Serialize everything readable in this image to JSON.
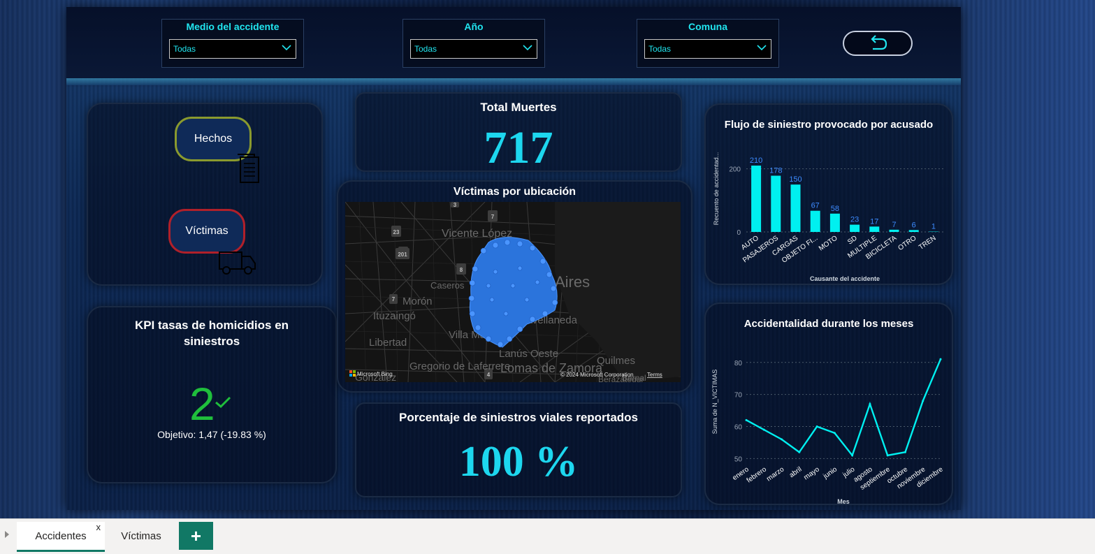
{
  "filters": [
    {
      "label": "Medio del accidente",
      "value": "Todas"
    },
    {
      "label": "Año",
      "value": "Todas"
    },
    {
      "label": "Comuna",
      "value": "Todas"
    }
  ],
  "nav": {
    "hechos": "Hechos",
    "victimas": "Víctimas"
  },
  "kpi_homicidios": {
    "title": "KPI tasas de homicidios en siniestros",
    "value": "2",
    "target": "Objetivo: 1,47 (-19.83 %)"
  },
  "total_muertes": {
    "title": "Total Muertes",
    "value": "717"
  },
  "map": {
    "title": "Víctimas por ubicación",
    "labels": [
      "Vicente López",
      "Aires",
      "Caseros",
      "Morón",
      "Ituzaingó",
      "Avellaneda",
      "Libertad",
      "Villa Madero",
      "Lanús Oeste",
      "Quilmes",
      "Gregorio de Laferrere",
      "Lomas de Zamora",
      "Bernal",
      "González",
      "Berazategui"
    ],
    "route_badges": [
      "3",
      "7",
      "23",
      "201",
      "8",
      "7",
      "4"
    ],
    "brand": "Microsoft Bing",
    "copyright": "© 2024 Microsoft Corporation",
    "terms": "Terms"
  },
  "porcentaje": {
    "title": "Porcentaje de siniestros viales reportados",
    "value": "100 %"
  },
  "colors": {
    "accent": "#1dd7ef",
    "bar": "#00f0f0",
    "bar_label": "#3d8bff",
    "kpi_good": "#1fbf3c"
  },
  "chart_data": [
    {
      "type": "bar",
      "title": "Flujo de siniestro provocado por acusado",
      "xlabel": "Causante del accidente",
      "ylabel": "Recuento de accidentad...",
      "categories": [
        "AUTO",
        "PASAJEROS",
        "CARGAS",
        "OBJETO FI...",
        "MOTO",
        "SD",
        "MULTIPLE",
        "BICICLETA",
        "OTRO",
        "TREN"
      ],
      "values": [
        210,
        178,
        150,
        67,
        58,
        23,
        17,
        7,
        6,
        1
      ],
      "yticks": [
        0,
        200
      ],
      "ylim": [
        0,
        230
      ],
      "grid": true
    },
    {
      "type": "line",
      "title": "Accidentalidad durante los meses",
      "xlabel": "Mes",
      "ylabel": "Suma de N_VICTIMAS",
      "categories": [
        "enero",
        "febrero",
        "marzo",
        "abril",
        "mayo",
        "junio",
        "julio",
        "agosto",
        "septiembre",
        "octubre",
        "noviembre",
        "diciembre"
      ],
      "values": [
        62,
        59,
        56,
        52,
        60,
        58,
        51,
        67,
        51,
        52,
        68,
        81
      ],
      "yticks": [
        50,
        60,
        70,
        80
      ],
      "ylim": [
        49,
        83
      ],
      "grid": true
    }
  ],
  "tabs": [
    {
      "label": "Accidentes",
      "close": "x"
    },
    {
      "label": "Víctimas"
    }
  ],
  "add_tab": "+"
}
